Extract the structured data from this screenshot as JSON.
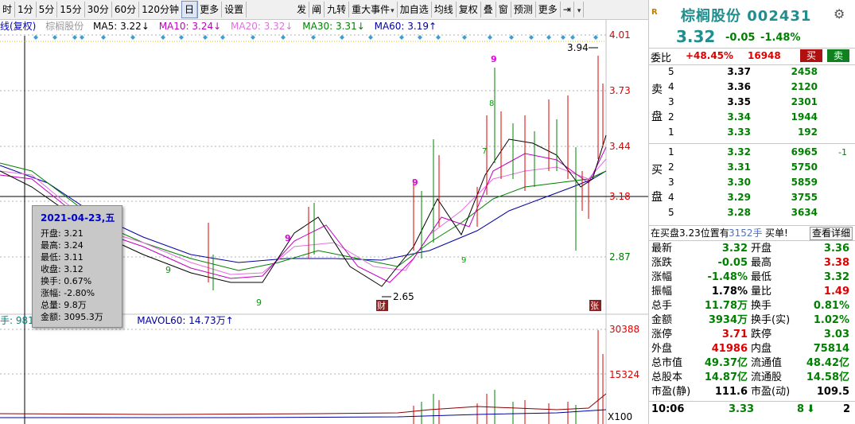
{
  "toolbar": {
    "left_items": [
      "时",
      "1分",
      "5分",
      "15分",
      "30分",
      "60分",
      "120分钟",
      "日",
      "更多",
      "设置"
    ],
    "right_items": [
      "发",
      "阐",
      "九转",
      "重大事件",
      "加自选",
      "均线",
      "复权",
      "叠",
      "窗",
      "预测",
      "更多"
    ]
  },
  "chart": {
    "title_items": [
      {
        "text": "线(复权)",
        "color": "#0000c0"
      },
      {
        "text": "棕榈股份",
        "color": "#999999"
      },
      {
        "text": "MA5: 3.22↓",
        "color": "#000000"
      },
      {
        "text": "MA10: 3.24↓",
        "color": "#c000c0"
      },
      {
        "text": "MA20: 3.32↓",
        "color": "#e070e0"
      },
      {
        "text": "MA30: 3.31↓",
        "color": "#008000"
      },
      {
        "text": "MA60: 3.19↑",
        "color": "#0000a0"
      }
    ],
    "price_labels": [
      "4.01",
      "3.73",
      "3.44",
      "3.18",
      "2.87"
    ],
    "volume_labels": [
      "30388",
      "15324",
      "X100"
    ],
    "high_label": "3.94",
    "low_label": "2.65",
    "badge_left": "财",
    "badge_right": "张",
    "count_marks": [
      "9",
      "8",
      "7",
      "9",
      "9",
      "9",
      "9",
      "9"
    ]
  },
  "volume": {
    "title_items": [
      {
        "text": "手: 9816",
        "color": "#008080"
      },
      {
        "text": "MAVOL60: 14.73万↑",
        "color": "#0000a0"
      }
    ]
  },
  "info_box": {
    "date": "2021-04-23,五",
    "rows": [
      "开盘: 3.21",
      "最高: 3.24",
      "最低: 3.11",
      "收盘: 3.12",
      "换手: 0.67%",
      "涨幅: -2.80%",
      "总量: 9.8万",
      "金额: 3095.3万"
    ]
  },
  "quote": {
    "name": "棕榈股份 002431",
    "price": "3.32",
    "change": "-0.05",
    "pct": "-1.48%",
    "weibi_label": "委比",
    "weibi_value": "+48.45%",
    "weibi_vol": "16948",
    "buy_btn": "买",
    "sell_btn": "卖",
    "sell_label": [
      "卖",
      "盘"
    ],
    "buy_label": [
      "买",
      "盘"
    ],
    "asks": [
      {
        "level": "5",
        "price": "3.37",
        "vol": "2458"
      },
      {
        "level": "4",
        "price": "3.36",
        "vol": "2120"
      },
      {
        "level": "3",
        "price": "3.35",
        "vol": "2301"
      },
      {
        "level": "2",
        "price": "3.34",
        "vol": "1944"
      },
      {
        "level": "1",
        "price": "3.33",
        "vol": "192"
      }
    ],
    "bids": [
      {
        "level": "1",
        "price": "3.32",
        "vol": "6965",
        "extra": "-1"
      },
      {
        "level": "2",
        "price": "3.31",
        "vol": "5750",
        "extra": ""
      },
      {
        "level": "3",
        "price": "3.30",
        "vol": "5859",
        "extra": ""
      },
      {
        "level": "4",
        "price": "3.29",
        "vol": "3755",
        "extra": ""
      },
      {
        "level": "5",
        "price": "3.28",
        "vol": "3634",
        "extra": ""
      }
    ],
    "notice": "在买盘3.23位置有",
    "notice_vol": "3152手",
    "notice_tail": "买单!",
    "detail_btn": "查看详细",
    "stats": [
      {
        "l1": "最新",
        "v1": "3.32",
        "c1": "g",
        "l2": "开盘",
        "v2": "3.36",
        "c2": "g"
      },
      {
        "l1": "涨跌",
        "v1": "-0.05",
        "c1": "g",
        "l2": "最高",
        "v2": "3.38",
        "c2": "r"
      },
      {
        "l1": "涨幅",
        "v1": "-1.48%",
        "c1": "g",
        "l2": "最低",
        "v2": "3.32",
        "c2": "g"
      },
      {
        "l1": "振幅",
        "v1": "1.78%",
        "c1": "k",
        "l2": "量比",
        "v2": "1.49",
        "c2": "r"
      },
      {
        "l1": "总手",
        "v1": "11.78万",
        "c1": "k",
        "l2": "换手",
        "v2": "0.81%",
        "c2": "k"
      },
      {
        "l1": "金额",
        "v1": "3934万",
        "c1": "k",
        "l2": "换手(实)",
        "v2": "1.02%",
        "c2": "k"
      },
      {
        "l1": "涨停",
        "v1": "3.71",
        "c1": "r",
        "l2": "跌停",
        "v2": "3.03",
        "c2": "g"
      },
      {
        "l1": "外盘",
        "v1": "41986",
        "c1": "r",
        "l2": "内盘",
        "v2": "75814",
        "c2": "g"
      },
      {
        "l1": "总市值",
        "v1": "49.37亿",
        "c1": "k",
        "l2": "流通值",
        "v2": "48.42亿",
        "c2": "k"
      },
      {
        "l1": "总股本",
        "v1": "14.87亿",
        "c1": "k",
        "l2": "流通股",
        "v2": "14.58亿",
        "c2": "k"
      },
      {
        "l1": "市盈(静)",
        "v1": "111.6",
        "c1": "k",
        "l2": "市盈(动)",
        "v2": "109.5",
        "c2": "k"
      }
    ],
    "tick": {
      "time": "10:06",
      "price": "3.33",
      "vol": "8",
      "extra": "2"
    }
  }
}
